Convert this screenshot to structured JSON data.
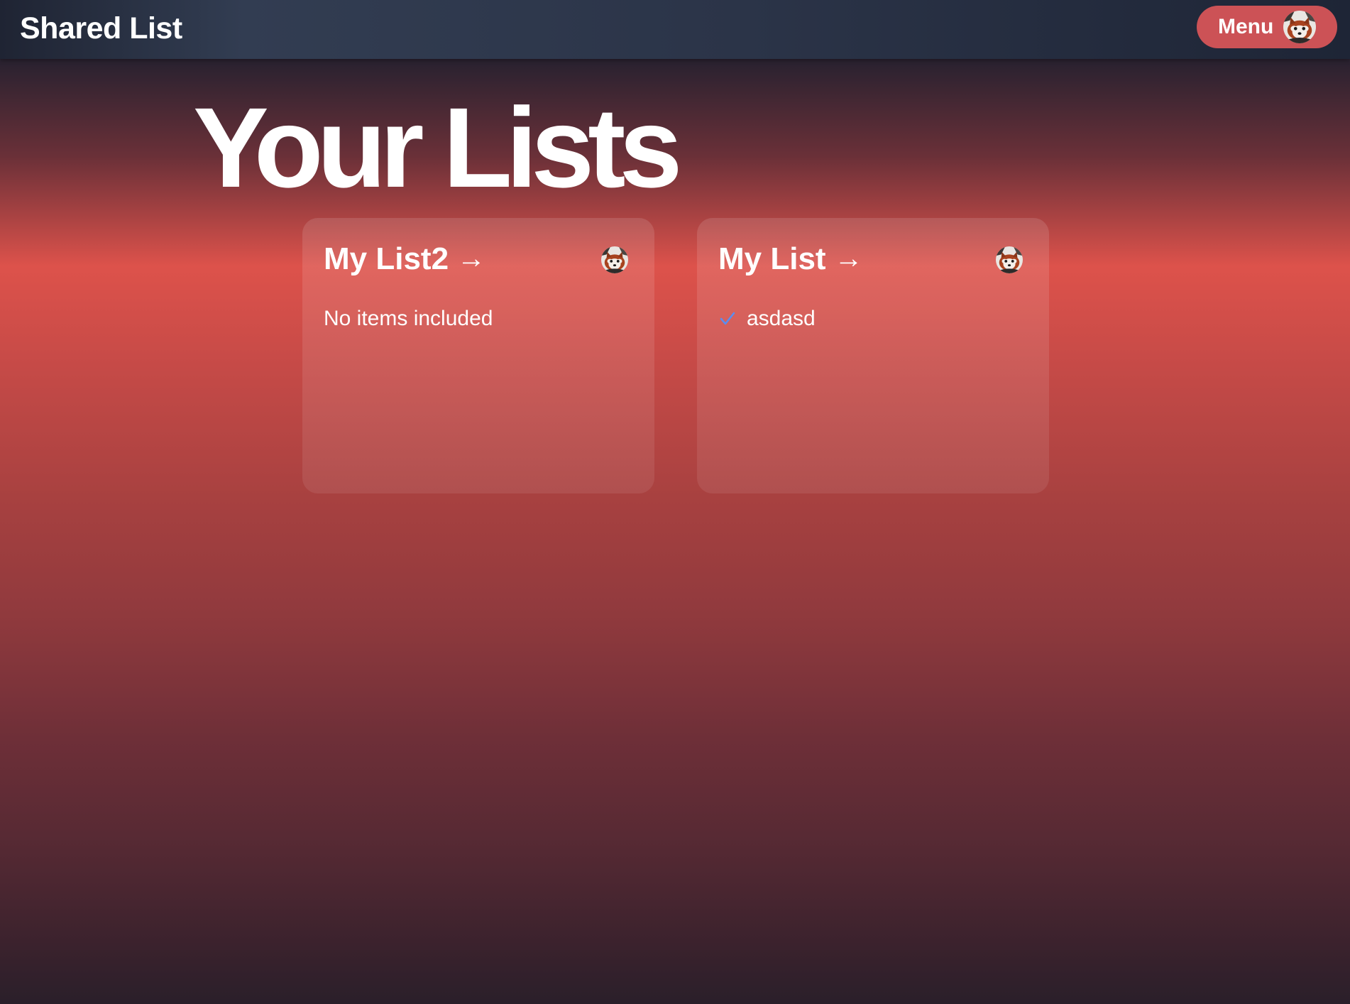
{
  "header": {
    "app_title": "Shared List",
    "menu_label": "Menu",
    "menu_avatar_icon": "red-panda-avatar"
  },
  "main": {
    "title": "Your Lists",
    "lists": [
      {
        "title": "My List2",
        "arrow": "→",
        "owner_avatar_icon": "red-panda-avatar",
        "empty_text": "No items included",
        "items": []
      },
      {
        "title": "My List",
        "arrow": "→",
        "owner_avatar_icon": "red-panda-avatar",
        "items": [
          {
            "label": "asdasd",
            "checked": true,
            "icon": "checkmark-icon"
          }
        ]
      }
    ]
  },
  "colors": {
    "topbar": "#2b3448",
    "menu_button": "#cc5256",
    "accent_red": "#dd524b",
    "check": "#5b8def"
  }
}
